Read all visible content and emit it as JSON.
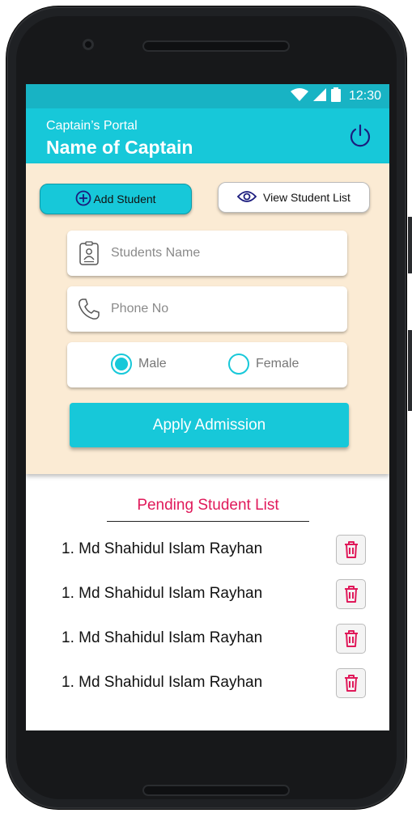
{
  "status_bar": {
    "time": "12:30"
  },
  "app_bar": {
    "subtitle": "Captain’s Portal",
    "title": "Name of Captain"
  },
  "actions": {
    "add_student": "Add Student",
    "view_student_list": "View Student List"
  },
  "form": {
    "name_placeholder": "Students Name",
    "phone_placeholder": "Phone No",
    "gender_options": [
      "Male",
      "Female"
    ],
    "selected_gender": "Male",
    "submit_label": "Apply Admission"
  },
  "pending": {
    "title": "Pending Student List",
    "students": [
      "1. Md Shahidul Islam Rayhan",
      "1. Md Shahidul Islam Rayhan",
      "1. Md Shahidul Islam Rayhan",
      "1. Md Shahidul Islam Rayhan"
    ]
  },
  "colors": {
    "primary": "#17c8d9",
    "form_background": "#fbebd4",
    "accent": "#e0195a",
    "icon": "#1b1c7e"
  }
}
